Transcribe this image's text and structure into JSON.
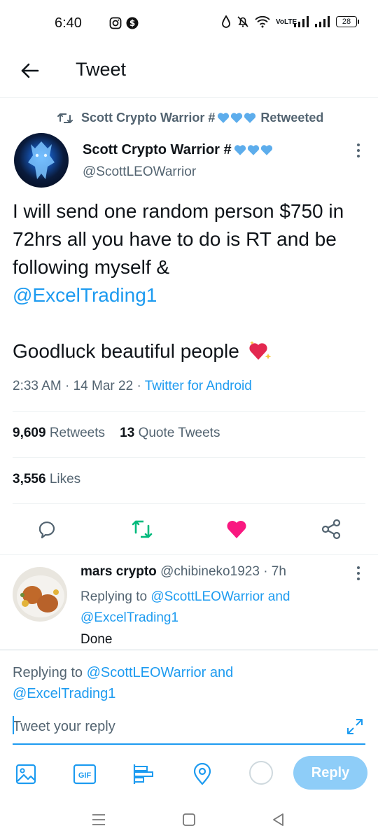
{
  "status_bar": {
    "time": "6:40",
    "volte_top": "Vo",
    "volte_bottom": "LTE",
    "battery": "28"
  },
  "header": {
    "title": "Tweet"
  },
  "retweet": {
    "retweeter": "Scott Crypto Warrior #",
    "label": "Retweeted"
  },
  "tweet": {
    "author_name": "Scott Crypto Warrior #",
    "handle": "@ScottLEOWarrior",
    "text_part1": "I will send one random person $750 in 72hrs all you have to do is RT and be following myself &",
    "mention": "@ExcelTrading1",
    "text_part2": "Goodluck beautiful people",
    "time": "2:33 AM",
    "date": "14 Mar 22",
    "source": "Twitter for Android",
    "retweets_count": "9,609",
    "retweets_label": "Retweets",
    "quotes_count": "13",
    "quotes_label": "Quote Tweets",
    "likes_count": "3,556",
    "likes_label": "Likes"
  },
  "reply": {
    "name": "mars crypto",
    "handle": "@chibineko1923",
    "age": "7h",
    "replying_prefix": "Replying to",
    "mention1": "@ScottLEOWarrior",
    "and": "and",
    "mention2": "@ExcelTrading1",
    "text": "Done"
  },
  "composer": {
    "replying_prefix": "Replying to",
    "mention1": "@ScottLEOWarrior",
    "and": "and",
    "mention2": "@ExcelTrading1",
    "placeholder": "Tweet your reply",
    "reply_button": "Reply"
  },
  "colors": {
    "accent": "#1d9bf0",
    "retweet_green": "#00ba7c",
    "like_pink": "#f91880",
    "reply_disabled": "#8ecdf8"
  },
  "icons": {
    "back": "arrow-left-icon",
    "more": "more-vertical-icon",
    "reply": "comment-icon",
    "retweet": "retweet-icon",
    "like": "heart-icon",
    "share": "share-icon",
    "media": "image-icon",
    "gif": "gif-icon",
    "poll": "poll-icon",
    "location": "location-pin-icon"
  }
}
